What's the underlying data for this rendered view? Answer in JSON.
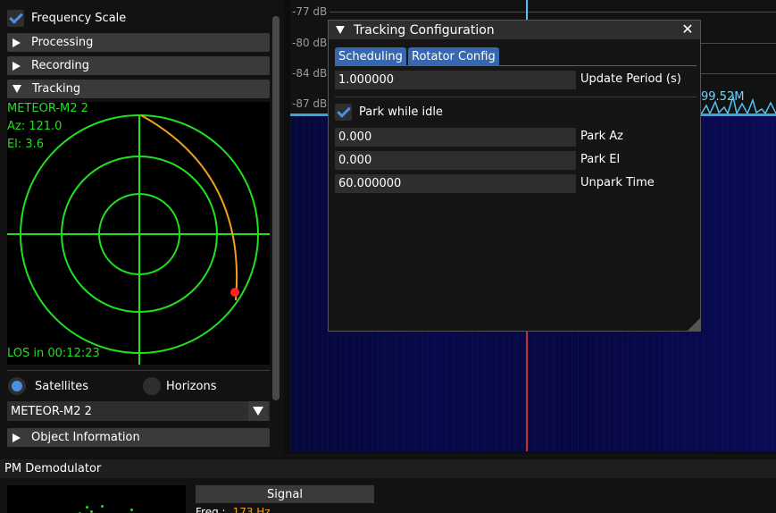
{
  "left_panel": {
    "frequency_scale": {
      "label": "Frequency Scale",
      "checked": true
    },
    "sections": [
      {
        "label": "Processing",
        "expanded": false
      },
      {
        "label": "Recording",
        "expanded": false
      },
      {
        "label": "Tracking",
        "expanded": true
      }
    ],
    "tracking": {
      "satellite_name": "METEOR-M2 2",
      "azimuth": "Az: 121.0",
      "elevation": "El: 3.6",
      "los": "LOS in 00:12:23",
      "mode_options": {
        "satellites": "Satellites",
        "horizons": "Horizons",
        "selected": "satellites"
      },
      "selected_object": "METEOR-M2 2"
    },
    "object_information": {
      "label": "Object Information",
      "expanded": false
    }
  },
  "fft": {
    "db_labels": [
      "-77 dB",
      "-80 dB",
      "-84 dB",
      "-87 dB"
    ],
    "marker_frequency": "99.52M",
    "trace_color": "#4fc3f7"
  },
  "dialog": {
    "title": "Tracking Configuration",
    "tabs": [
      "Scheduling",
      "Rotator Config"
    ],
    "update_period": {
      "value": "1.000000",
      "label": "Update Period (s)"
    },
    "park_while_idle": {
      "label": "Park while idle",
      "checked": true
    },
    "park_az": {
      "value": "0.000",
      "label": "Park Az"
    },
    "park_el": {
      "value": "0.000",
      "label": "Park El"
    },
    "unpark_time": {
      "value": "60.000000",
      "label": "Unpark Time"
    }
  },
  "pm_demodulator": {
    "title": "PM Demodulator",
    "signal_header": "Signal",
    "freq_label": "Freq :",
    "freq_value": "173 Hz"
  },
  "colors": {
    "accent": "#4a90e2",
    "polar_grid": "#20e020",
    "track": "#f0a020",
    "satellite_dot": "#ff2020"
  }
}
